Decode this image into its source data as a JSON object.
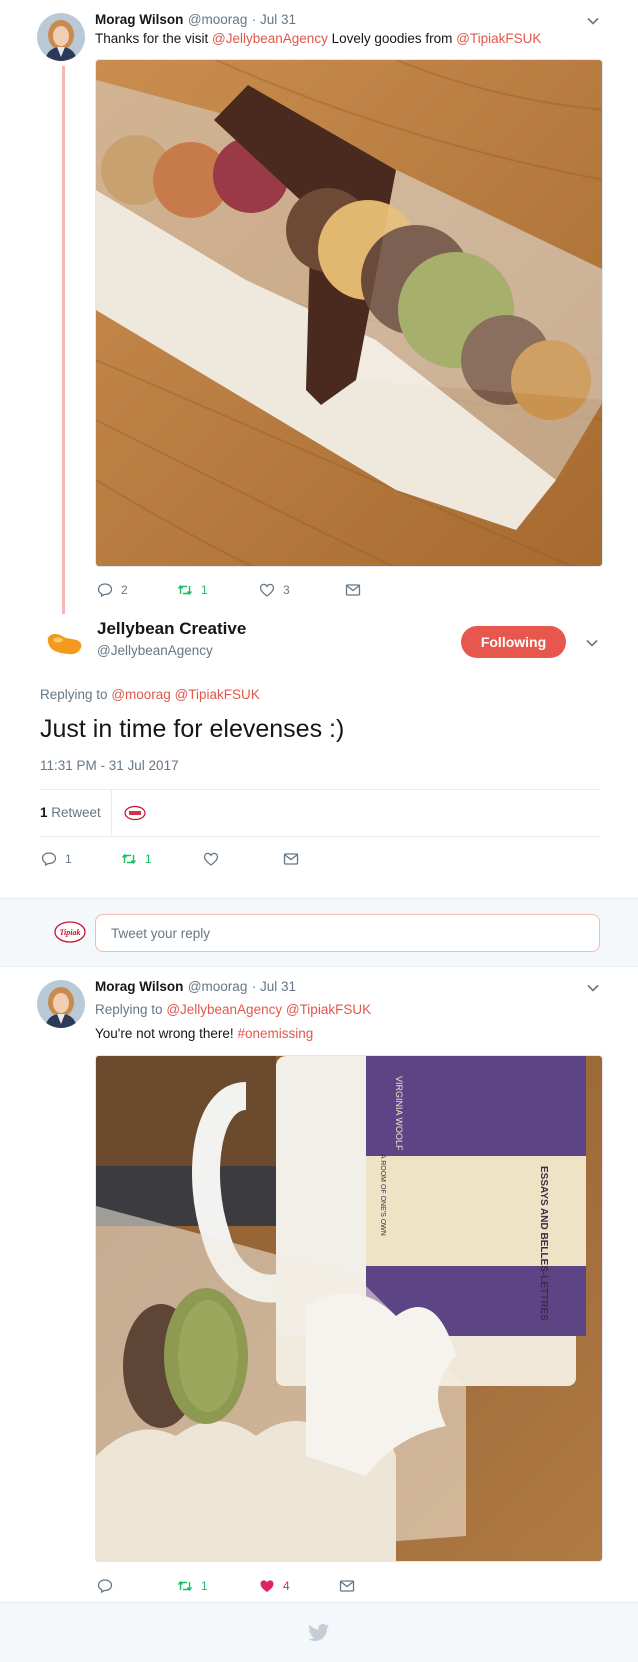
{
  "tweet1": {
    "author_name": "Morag Wilson",
    "author_handle": "@moorag",
    "date": "· Jul 31",
    "text_pre": "Thanks for the visit ",
    "mention1": "@JellybeanAgency",
    "text_mid": " Lovely goodies from ",
    "mention2": "@TipiakFSUK",
    "replies": "2",
    "retweets": "1",
    "likes": "3"
  },
  "main_tweet": {
    "author_name": "Jellybean Creative",
    "author_handle": "@JellybeanAgency",
    "follow_label": "Following",
    "replying_label": "Replying to",
    "reply_mention1": "@moorag",
    "reply_mention2": "@TipiakFSUK",
    "text": "Just in time for elevenses :)",
    "timestamp": "11:31 PM - 31 Jul 2017",
    "retweet_count": "1",
    "retweet_label": "Retweet",
    "replies": "1",
    "retweets": "1"
  },
  "reply_box": {
    "placeholder": "Tweet your reply"
  },
  "tweet2": {
    "author_name": "Morag Wilson",
    "author_handle": "@moorag",
    "date": "· Jul 31",
    "replying_label": "Replying to",
    "reply_mention1": "@JellybeanAgency",
    "reply_mention2": "@TipiakFSUK",
    "text_pre": "You're not wrong there! ",
    "hashtag": "#onemissing",
    "retweets": "1",
    "likes": "4",
    "mug_text1": "VIRGINIA WOOLF",
    "mug_text2": "A ROOM OF ONE'S OWN",
    "mug_text3": "ESSAYS AND BELLES-LETTRES"
  },
  "logo_text": "Tipiak",
  "colors": {
    "accent": "#e0574b",
    "retweet": "#17bf63",
    "like": "#e0245e",
    "muted": "#657786"
  }
}
